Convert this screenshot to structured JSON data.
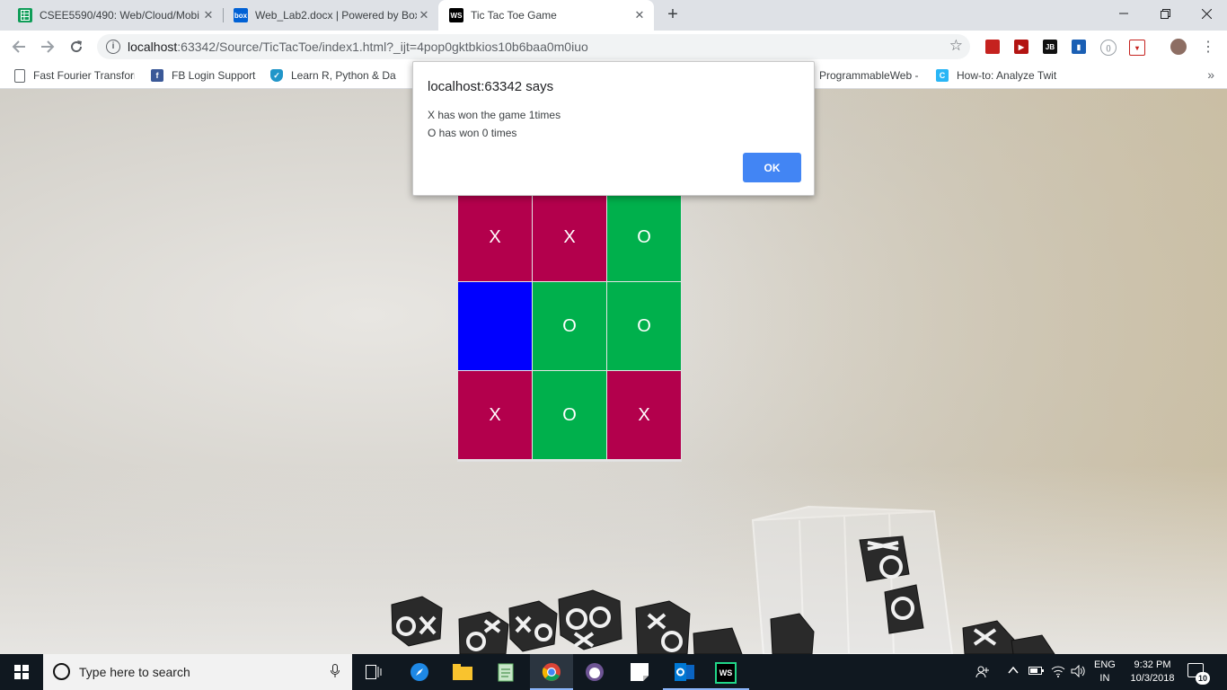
{
  "browser": {
    "tabs": [
      {
        "title": "CSEE5590/490: Web/Cloud/Mobi",
        "icon": "google-sheets-icon",
        "color": "#0f9d58"
      },
      {
        "title": "Web_Lab2.docx | Powered by Box",
        "icon": "box-icon",
        "icon_text": "box",
        "color": "#0061d5"
      },
      {
        "title": "Tic Tac Toe Game",
        "icon": "webstorm-icon",
        "icon_text": "WS",
        "color": "#000000",
        "active": true
      }
    ],
    "address": {
      "host": "localhost",
      "rest": ":63342/Source/TicTacToe/index1.html?_ijt=4pop0gktbkios10b6baa0m0iuo"
    },
    "bookmarks": [
      {
        "label": "Fast Fourier Transform",
        "icon": "page-icon"
      },
      {
        "label": "FB Login Support",
        "icon": "facebook-icon"
      },
      {
        "label": "Learn R, Python & Da",
        "icon": "shield-icon"
      },
      {
        "label": "ProgrammableWeb -",
        "icon": "page-icon"
      },
      {
        "label": "How-to: Analyze Twit",
        "icon": "c-icon"
      }
    ],
    "more_bookmarks": "»"
  },
  "game": {
    "board": [
      [
        "X",
        "X",
        "O"
      ],
      [
        "",
        "O",
        "O"
      ],
      [
        "X",
        "O",
        "X"
      ]
    ],
    "colors": {
      "x": "#b3004c",
      "o": "#00b04c",
      "empty": "#0000ff"
    }
  },
  "dialog": {
    "title": "localhost:63342 says",
    "line1": "X has won the game 1times",
    "line2": "O has won 0 times",
    "ok_label": "OK"
  },
  "taskbar": {
    "search_placeholder": "Type here to search",
    "lang_top": "ENG",
    "lang_bottom": "IN",
    "time": "9:32 PM",
    "date": "10/3/2018",
    "notification_count": "10"
  }
}
